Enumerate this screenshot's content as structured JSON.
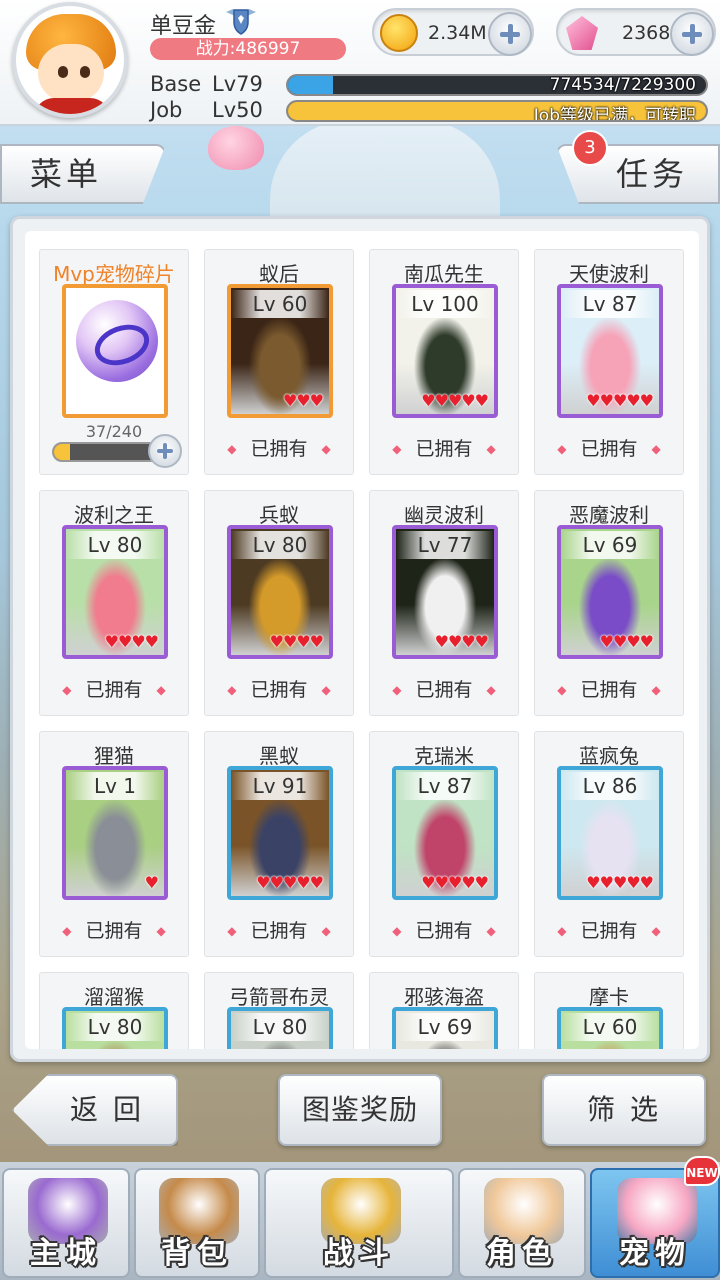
{
  "player": {
    "name": "单豆金",
    "power": "战力:486997",
    "base_label": "Base",
    "base_level": "Lv79",
    "base_exp": "774534/7229300",
    "base_progress": 0.107,
    "job_label": "Job",
    "job_level": "Lv50",
    "job_status": "Job等级已满，可转职",
    "job_progress": 1.0
  },
  "resources": {
    "zeny": "2.34M",
    "gems": "2368"
  },
  "tabs": {
    "menu": "菜单",
    "tasks": "任务",
    "task_badge": "3"
  },
  "mvp_fragment": {
    "title": "Mvp宠物碎片",
    "progress_text": "37/240",
    "progress": 0.154
  },
  "pets": [
    {
      "name": "蚁后",
      "level": "Lv 60",
      "hearts": "♥♥♥",
      "status": "已拥有",
      "rarity": "orange",
      "bg": "#3b2516",
      "accent": "#7a5a2e"
    },
    {
      "name": "南瓜先生",
      "level": "Lv 100",
      "hearts": "♥♥♥♥♥",
      "status": "已拥有",
      "rarity": "purple",
      "bg": "#f2f2ea",
      "accent": "#2e3a2a"
    },
    {
      "name": "天使波利",
      "level": "Lv 87",
      "hearts": "♥♥♥♥♥",
      "status": "已拥有",
      "rarity": "purple",
      "bg": "#dceef7",
      "accent": "#f6a3b8"
    },
    {
      "name": "波利之王",
      "level": "Lv 80",
      "hearts": "♥♥♥♥",
      "status": "已拥有",
      "rarity": "purple",
      "bg": "#b9dfa9",
      "accent": "#f07c8e"
    },
    {
      "name": "兵蚁",
      "level": "Lv 80",
      "hearts": "♥♥♥♥",
      "status": "已拥有",
      "rarity": "purple",
      "bg": "#4d3a22",
      "accent": "#d49a2a"
    },
    {
      "name": "幽灵波利",
      "level": "Lv 77",
      "hearts": "♥♥♥♥",
      "status": "已拥有",
      "rarity": "purple",
      "bg": "#1e2418",
      "accent": "#f0f0f0"
    },
    {
      "name": "恶魔波利",
      "level": "Lv 69",
      "hearts": "♥♥♥♥",
      "status": "已拥有",
      "rarity": "purple",
      "bg": "#a9d48c",
      "accent": "#7a4cc8"
    },
    {
      "name": "狸猫",
      "level": "Lv 1",
      "hearts": "♥",
      "status": "已拥有",
      "rarity": "purple",
      "bg": "#a9cf82",
      "accent": "#8a8e96"
    },
    {
      "name": "黑蚁",
      "level": "Lv 91",
      "hearts": "♥♥♥♥♥",
      "status": "已拥有",
      "rarity": "blue",
      "bg": "#7a5428",
      "accent": "#3a4266"
    },
    {
      "name": "克瑞米",
      "level": "Lv 87",
      "hearts": "♥♥♥♥♥",
      "status": "已拥有",
      "rarity": "blue",
      "bg": "#bfe3c4",
      "accent": "#c0446a"
    },
    {
      "name": "蓝疯兔",
      "level": "Lv 86",
      "hearts": "♥♥♥♥♥",
      "status": "已拥有",
      "rarity": "blue",
      "bg": "#cde8f0",
      "accent": "#e6e2f2"
    },
    {
      "name": "溜溜猴",
      "level": "Lv 80",
      "hearts": "",
      "status": "",
      "rarity": "blue",
      "bg": "#b9dfa0",
      "accent": "#b08e5a"
    },
    {
      "name": "弓箭哥布灵",
      "level": "Lv 80",
      "hearts": "",
      "status": "",
      "rarity": "blue",
      "bg": "#c8d0c8",
      "accent": "#6a6a6a"
    },
    {
      "name": "邪骇海盗",
      "level": "Lv 69",
      "hearts": "",
      "status": "",
      "rarity": "blue",
      "bg": "#e8e8e0",
      "accent": "#444444"
    },
    {
      "name": "摩卡",
      "level": "Lv 60",
      "hearts": "",
      "status": "",
      "rarity": "blue",
      "bg": "#b9dfa0",
      "accent": "#c89a5a"
    }
  ],
  "actions": {
    "back": "返 回",
    "reward": "图鉴奖励",
    "filter": "筛 选"
  },
  "nav": [
    {
      "label": "主城",
      "icon": "castle-icon",
      "color": "#9a6ad0"
    },
    {
      "label": "背包",
      "icon": "backpack-icon",
      "color": "#c58a4a"
    },
    {
      "label": "战斗",
      "icon": "battle-icon",
      "color": "#e6b43a"
    },
    {
      "label": "角色",
      "icon": "character-icon",
      "color": "#f0c89a"
    },
    {
      "label": "宠物",
      "icon": "pet-icon",
      "color": "#f7a7c3"
    }
  ],
  "nav_new_badge": "NEW",
  "colors": {
    "power_bg": "#f07a82",
    "base_bar": "#3aa4e6",
    "job_bar": "#f7c33a",
    "heart": "#e8202e"
  }
}
